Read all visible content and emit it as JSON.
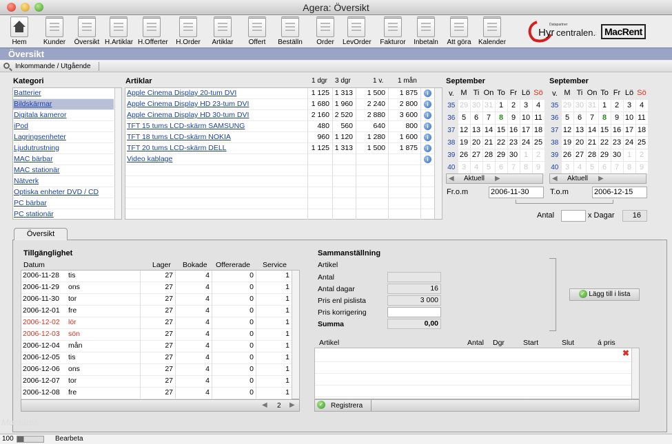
{
  "window": {
    "title": "Agera: Översikt"
  },
  "toolbar": [
    {
      "label": "Hem",
      "icon": "home-icon"
    },
    {
      "label": "Kunder",
      "icon": "document-icon"
    },
    {
      "label": "Översikt",
      "icon": "document-icon"
    },
    {
      "label": "H.Artiklar",
      "icon": "document-icon"
    },
    {
      "label": "H.Offerter",
      "icon": "document-icon"
    },
    {
      "label": "H.Order",
      "icon": "document-icon"
    },
    {
      "label": "Artiklar",
      "icon": "document-icon"
    },
    {
      "label": "Offert",
      "icon": "document-icon"
    },
    {
      "label": "Beställn",
      "icon": "document-icon"
    },
    {
      "label": "Order",
      "icon": "document-icon"
    },
    {
      "label": "LevOrder",
      "icon": "document-icon"
    },
    {
      "label": "Fakturor",
      "icon": "document-icon"
    },
    {
      "label": "Inbetaln",
      "icon": "document-icon"
    },
    {
      "label": "Att göra",
      "icon": "document-icon"
    },
    {
      "label": "Kalender",
      "icon": "document-icon"
    }
  ],
  "logos": {
    "hyr_small": "Datapartner",
    "hyr_main_a": "Hyr",
    "hyr_main_b": "centralen.se",
    "macrent": "MacRent"
  },
  "header": {
    "title": "Översikt"
  },
  "subbar": {
    "label": "Inkommande / Utgående"
  },
  "kategori": {
    "title": "Kategori",
    "items": [
      "Batterier",
      "Bildskärmar",
      "Digitala kameror",
      "iPod",
      "Lagringsenheter",
      "Ljudutrustning",
      "MAC bärbar",
      "MAC stationär",
      "Nätverk",
      "Optiska enheter DVD / CD",
      "PC bärbar",
      "PC stationär"
    ],
    "selected": "Bildskärmar"
  },
  "artiklar": {
    "title": "Artiklar",
    "columns": [
      "1 dgr",
      "3 dgr",
      "1 v.",
      "1 mån"
    ],
    "rows": [
      {
        "name": "Apple Cinema Display 20-tum DVI",
        "d1": "1 125",
        "d3": "1 313",
        "w1": "1 500",
        "m1": "1 875"
      },
      {
        "name": "Apple Cinema Display HD 23-tum DVI",
        "d1": "1 680",
        "d3": "1 960",
        "w1": "2 240",
        "m1": "2 800"
      },
      {
        "name": "Apple Cinema Display HD 30-tum DVI",
        "d1": "2 160",
        "d3": "2 520",
        "w1": "2 880",
        "m1": "3 600"
      },
      {
        "name": "TFT 15 tums LCD-skärm SAMSUNG",
        "d1": "480",
        "d3": "560",
        "w1": "640",
        "m1": "800"
      },
      {
        "name": "TFT 18 tums LCD-skärm NOKIA",
        "d1": "960",
        "d3": "1 120",
        "w1": "1 280",
        "m1": "1 600"
      },
      {
        "name": "TFT 20 tums LCD-skärm DELL",
        "d1": "1 125",
        "d3": "1 313",
        "w1": "1 500",
        "m1": "1 875"
      },
      {
        "name": "Video kablage",
        "d1": "",
        "d3": "",
        "w1": "",
        "m1": ""
      }
    ]
  },
  "calendars": [
    {
      "month": "September",
      "headers": [
        "v.",
        "M",
        "Ti",
        "On",
        "To",
        "Fr",
        "Lö",
        "Sö"
      ],
      "weeks": [
        {
          "w": "35",
          "days": [
            "29",
            "30",
            "31",
            "1",
            "2",
            "3",
            "4"
          ]
        },
        {
          "w": "36",
          "days": [
            "5",
            "6",
            "7",
            "8",
            "9",
            "10",
            "11"
          ]
        },
        {
          "w": "37",
          "days": [
            "12",
            "13",
            "14",
            "15",
            "16",
            "17",
            "18"
          ]
        },
        {
          "w": "38",
          "days": [
            "19",
            "20",
            "21",
            "22",
            "23",
            "24",
            "25"
          ]
        },
        {
          "w": "39",
          "days": [
            "26",
            "27",
            "28",
            "29",
            "30",
            "1",
            "2"
          ]
        },
        {
          "w": "40",
          "days": [
            "3",
            "4",
            "5",
            "6",
            "7",
            "8",
            "9"
          ]
        }
      ],
      "button": "Aktuell"
    },
    {
      "month": "September",
      "headers": [
        "v.",
        "M",
        "Ti",
        "On",
        "To",
        "Fr",
        "Lö",
        "Sö"
      ],
      "weeks": [
        {
          "w": "35",
          "days": [
            "29",
            "30",
            "31",
            "1",
            "2",
            "3",
            "4"
          ]
        },
        {
          "w": "36",
          "days": [
            "5",
            "6",
            "7",
            "8",
            "9",
            "10",
            "11"
          ]
        },
        {
          "w": "37",
          "days": [
            "12",
            "13",
            "14",
            "15",
            "16",
            "17",
            "18"
          ]
        },
        {
          "w": "38",
          "days": [
            "19",
            "20",
            "21",
            "22",
            "23",
            "24",
            "25"
          ]
        },
        {
          "w": "39",
          "days": [
            "26",
            "27",
            "28",
            "29",
            "30",
            "1",
            "2"
          ]
        },
        {
          "w": "40",
          "days": [
            "3",
            "4",
            "5",
            "6",
            "7",
            "8",
            "9"
          ]
        }
      ],
      "button": "Aktuell"
    }
  ],
  "dates": {
    "from_label": "Fr.o.m",
    "from": "2006-11-30",
    "to_label": "T.o.m",
    "to": "2006-12-15",
    "antal_label": "Antal",
    "x_dagar_label": "x Dagar",
    "days": "16"
  },
  "tab": {
    "label": "Översikt"
  },
  "tillganglighet": {
    "title": "Tillgänglighet",
    "columns": [
      "Datum",
      "Lager",
      "Bokade",
      "Offererade",
      "Service"
    ],
    "rows": [
      {
        "date": "2006-11-28",
        "day": "tis",
        "lager": "27",
        "bokade": "4",
        "off": "0",
        "service": "1",
        "weekend": false
      },
      {
        "date": "2006-11-29",
        "day": "ons",
        "lager": "27",
        "bokade": "4",
        "off": "0",
        "service": "1",
        "weekend": false
      },
      {
        "date": "2006-11-30",
        "day": "tor",
        "lager": "27",
        "bokade": "4",
        "off": "0",
        "service": "1",
        "weekend": false
      },
      {
        "date": "2006-12-01",
        "day": "fre",
        "lager": "27",
        "bokade": "4",
        "off": "0",
        "service": "1",
        "weekend": false
      },
      {
        "date": "2006-12-02",
        "day": "lör",
        "lager": "27",
        "bokade": "4",
        "off": "0",
        "service": "1",
        "weekend": true
      },
      {
        "date": "2006-12-03",
        "day": "sön",
        "lager": "27",
        "bokade": "4",
        "off": "0",
        "service": "1",
        "weekend": true
      },
      {
        "date": "2006-12-04",
        "day": "mån",
        "lager": "27",
        "bokade": "4",
        "off": "0",
        "service": "1",
        "weekend": false
      },
      {
        "date": "2006-12-05",
        "day": "tis",
        "lager": "27",
        "bokade": "4",
        "off": "0",
        "service": "1",
        "weekend": false
      },
      {
        "date": "2006-12-06",
        "day": "ons",
        "lager": "27",
        "bokade": "4",
        "off": "0",
        "service": "1",
        "weekend": false
      },
      {
        "date": "2006-12-07",
        "day": "tor",
        "lager": "27",
        "bokade": "4",
        "off": "0",
        "service": "1",
        "weekend": false
      },
      {
        "date": "2006-12-08",
        "day": "fre",
        "lager": "27",
        "bokade": "4",
        "off": "0",
        "service": "1",
        "weekend": false
      }
    ],
    "page": "2"
  },
  "sammanstallning": {
    "title": "Sammanställning",
    "artikel_label": "Artikel",
    "antal_label": "Antal",
    "antal_dagar_label": "Antal dagar",
    "antal_dagar": "16",
    "pris_label": "Pris enl pislista",
    "pris": "3 000",
    "korr_label": "Pris korrigering",
    "summa_label": "Summa",
    "summa": "0,00",
    "add_button": "Lägg till i lista"
  },
  "orderlist": {
    "columns": [
      "Artikel",
      "Antal",
      "Dgr",
      "Start",
      "Slut",
      "á pris"
    ],
    "register_button": "Registrera"
  },
  "status": {
    "zoom": "100",
    "mode": "Bearbeta",
    "watermark": "Montania"
  }
}
